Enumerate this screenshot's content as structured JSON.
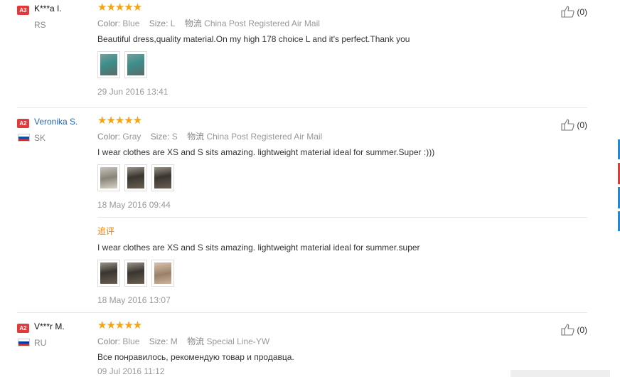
{
  "reviews": [
    {
      "badge": "A3",
      "name": "K***a I.",
      "name_link": false,
      "country": "RS",
      "stars": "★★★★★",
      "color_label": "Color:",
      "color": "Blue",
      "size_label": "Size:",
      "size": "L",
      "shipping_label": "物流",
      "shipping": "China Post Registered Air Mail",
      "text": "Beautiful dress,quality material.On my high 178 choice L and it's perfect.Thank you",
      "photos": [
        "teal",
        "teal"
      ],
      "date": "29 Jun 2016 13:41",
      "helpful": "(0)"
    },
    {
      "badge": "A2",
      "name": "Veronika S.",
      "name_link": true,
      "country": "SK",
      "flag_colors": [
        "#ffffff",
        "#0b4ea2",
        "#ee1c25"
      ],
      "stars": "★★★★★",
      "color_label": "Color:",
      "color": "Gray",
      "size_label": "Size:",
      "size": "S",
      "shipping_label": "物流",
      "shipping": "China Post Registered Air Mail",
      "text": "I wear clothes are XS and S sits amazing. lightweight material ideal for summer.Super :)))",
      "photos": [
        "gray",
        "dark",
        "dark"
      ],
      "date": "18 May 2016 09:44",
      "helpful": "(0)",
      "followup": {
        "label": "追评",
        "text": "I wear clothes are XS and S sits amazing. lightweight material ideal for summer.super",
        "photos": [
          "dark",
          "dark",
          "peach"
        ],
        "date": "18 May 2016 13:07"
      }
    },
    {
      "badge": "A2",
      "name": "V***r M.",
      "name_link": false,
      "country": "RU",
      "flag_colors": [
        "#ffffff",
        "#0039a6",
        "#d52b1e"
      ],
      "stars": "★★★★★",
      "color_label": "Color:",
      "color": "Blue",
      "size_label": "Size:",
      "size": "M",
      "shipping_label": "物流",
      "shipping": "Special Line-YW",
      "text": "Все понравилось, рекомендую товар и продавца.",
      "date": "09 Jul 2016 11:12",
      "helpful": "(0)"
    }
  ],
  "colors": {
    "badge": "#e4393c",
    "stars": "#f8a20f",
    "link": "#1f64c4",
    "followup": "#f08200",
    "side_tabs": [
      "#1e88e5",
      "#e53935",
      "#1e88e5",
      "#1e88e5"
    ]
  }
}
